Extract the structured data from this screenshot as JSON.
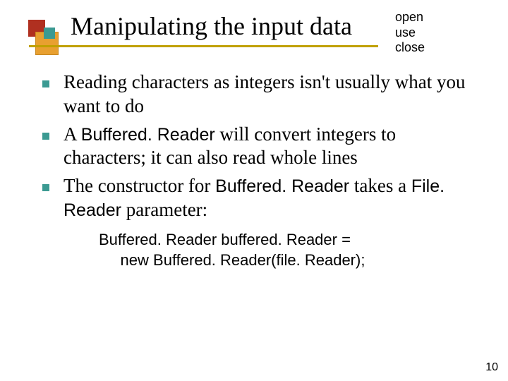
{
  "header": {
    "title": "Manipulating the input data",
    "side_note_line1": "open",
    "side_note_line2": "use",
    "side_note_line3": "close"
  },
  "bullets": {
    "b0": {
      "t1": "Reading characters as integers isn't usually what you want to do"
    },
    "b1": {
      "t1": "A ",
      "c1": "Buffered. Reader",
      "t2": " will convert integers to characters; it can also read whole lines"
    },
    "b2": {
      "t1": "The constructor for ",
      "c1": "Buffered. Reader",
      "t2": "  takes a ",
      "c2": "File. Reader",
      "t3": " parameter:"
    }
  },
  "sub": {
    "line1": "Buffered. Reader buffered. Reader =",
    "line2_indent": "     new Buffered. Reader(file. Reader);"
  },
  "page_number": "10"
}
